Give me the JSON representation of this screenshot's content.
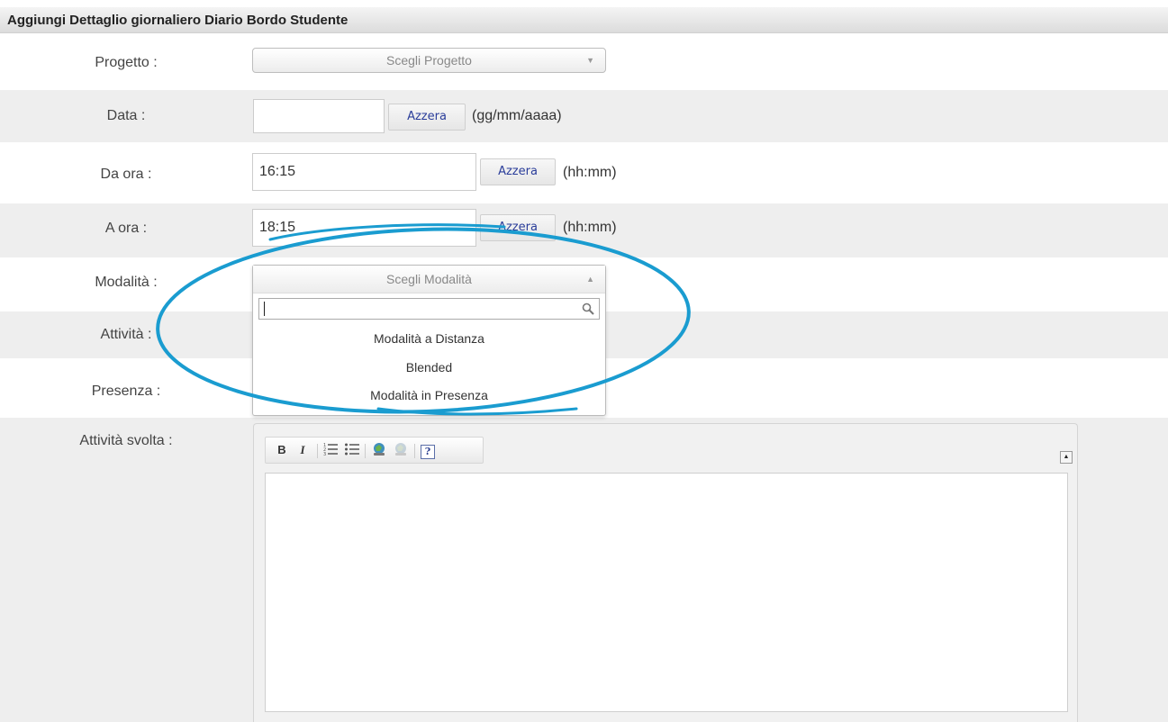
{
  "header": {
    "title": "Aggiungi Dettaglio giornaliero Diario Bordo Studente"
  },
  "fields": {
    "progetto": {
      "label": "Progetto :",
      "placeholder": "Scegli Progetto"
    },
    "data": {
      "label": "Data :",
      "value": "",
      "reset_label": "Azzera",
      "hint": "(gg/mm/aaaa)"
    },
    "da_ora": {
      "label": "Da ora :",
      "value": "16:15",
      "reset_label": "Azzera",
      "hint": "(hh:mm)"
    },
    "a_ora": {
      "label": "A ora :",
      "value": "18:15",
      "reset_label": "Azzera",
      "hint": "(hh:mm)"
    },
    "modalita": {
      "label": "Modalità :",
      "placeholder": "Scegli Modalità",
      "search_value": "",
      "options": [
        "Modalità a Distanza",
        "Blended",
        "Modalità in Presenza"
      ]
    },
    "attivita": {
      "label": "Attività :"
    },
    "presenza": {
      "label": "Presenza :"
    },
    "attivita_svolta": {
      "label": "Attività svolta :"
    }
  },
  "icons": {
    "arrow_down": "▼",
    "arrow_up": "▲",
    "search": "search-icon",
    "bold": "B",
    "italic": "I",
    "ordered_list": "ordered-list-icon",
    "unordered_list": "unordered-list-icon",
    "link": "link-icon",
    "unlink": "unlink-icon",
    "help": "?",
    "collapse": "▲"
  },
  "annotation": {
    "color": "#1a9cd0"
  }
}
